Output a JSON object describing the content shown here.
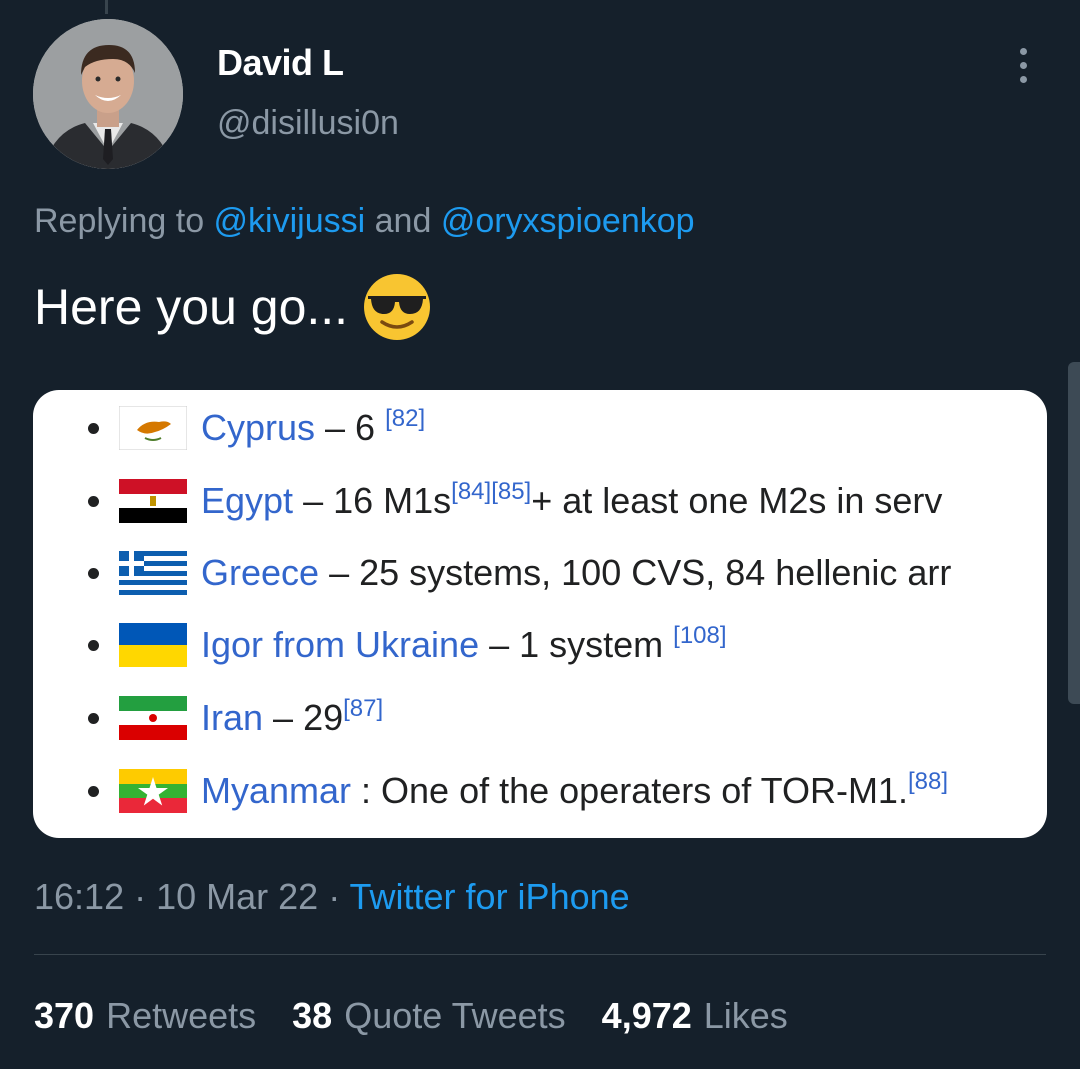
{
  "user": {
    "display_name": "David L",
    "handle": "@disillusi0n"
  },
  "reply": {
    "prefix": "Replying to ",
    "mention1": "@kivijussi",
    "joiner": " and ",
    "mention2": "@oryxspioenkop"
  },
  "tweet": {
    "text": "Here you go...",
    "emoji": "smiling-face-with-sunglasses"
  },
  "media": {
    "items": [
      {
        "flag": "cyprus-flag",
        "country": "Cyprus",
        "detail": " – 6 ",
        "refs": "[82]"
      },
      {
        "flag": "egypt-flag",
        "country": "Egypt",
        "detail": " – 16 M1s",
        "refs": "[84][85]",
        "detail_after": "+ at least one M2s in serv"
      },
      {
        "flag": "greece-flag",
        "country": "Greece",
        "detail": " – 25 systems, 100 CVS, 84 hellenic arr",
        "refs": ""
      },
      {
        "flag": "ukraine-flag",
        "country": "Igor from Ukraine",
        "detail": " – 1 system ",
        "refs": "[108]"
      },
      {
        "flag": "iran-flag",
        "country": "Iran",
        "detail": " – 29",
        "refs": "[87]"
      },
      {
        "flag": "myanmar-flag",
        "country": "Myanmar",
        "detail": " : One of the operaters of TOR-M1.",
        "refs": "[88]"
      }
    ]
  },
  "meta": {
    "time": "16:12",
    "sep1": " · ",
    "date": "10 Mar 22",
    "sep2": " · ",
    "source": "Twitter for iPhone"
  },
  "stats": {
    "retweets_count": "370",
    "retweets_label": "Retweets",
    "quotes_count": "38",
    "quotes_label": "Quote Tweets",
    "likes_count": "4,972",
    "likes_label": "Likes"
  },
  "colors": {
    "background": "#15202b",
    "link": "#1d9bf0",
    "muted": "#8b98a5",
    "wiki_link": "#3366cc"
  }
}
